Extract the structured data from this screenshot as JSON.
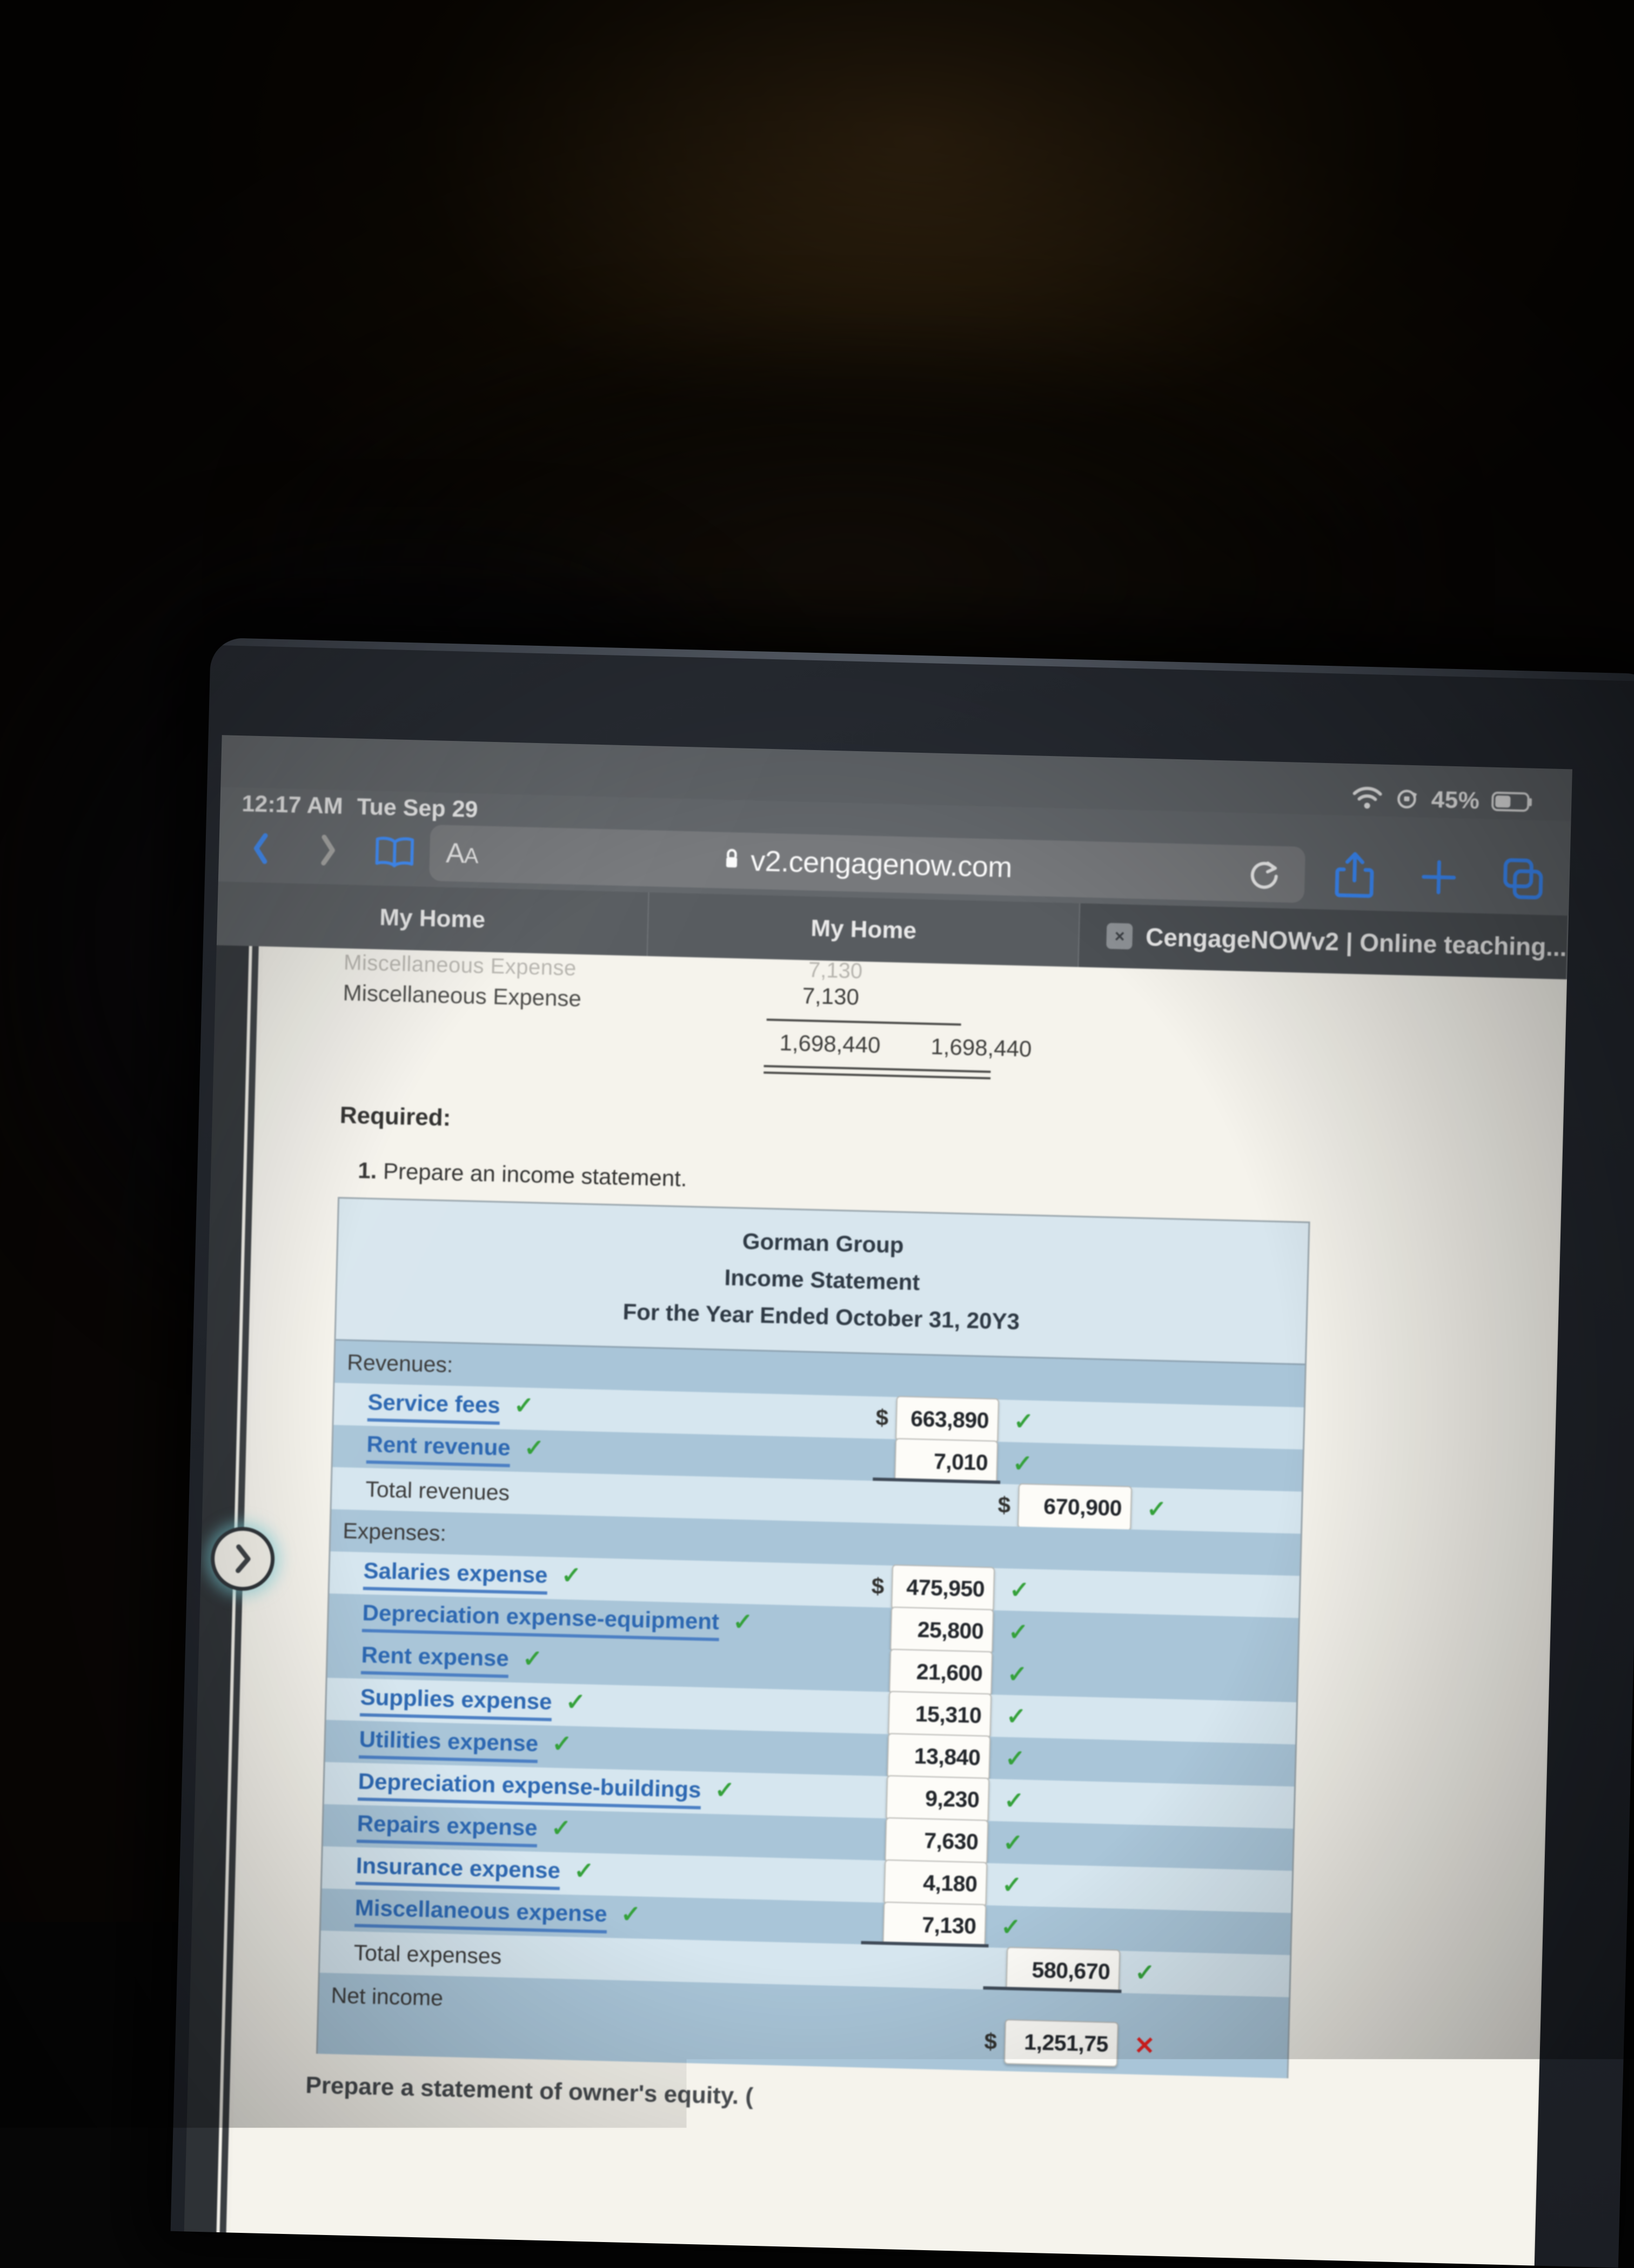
{
  "status_bar": {
    "time": "12:17 AM",
    "date": "Tue Sep 29",
    "battery_percent": "45%",
    "wifi_icon": "wifi-icon",
    "rotation_lock_icon": "rotation-lock-icon",
    "battery_icon": "battery-icon"
  },
  "toolbar": {
    "back_icon": "chevron-left-icon",
    "forward_icon": "chevron-right-icon",
    "bookmarks_icon": "book-icon",
    "text_size_label_big": "A",
    "text_size_label_small": "A",
    "lock_icon": "lock-icon",
    "url": "v2.cengagenow.com",
    "reload_icon": "reload-icon",
    "share_icon": "share-icon",
    "new_tab_icon": "plus-icon",
    "tabs_icon": "tab-overview-icon"
  },
  "tabs": [
    {
      "label": "My Home",
      "active": false,
      "closable": false
    },
    {
      "label": "My Home",
      "active": false,
      "closable": false
    },
    {
      "label": "CengageNOWv2 | Online teaching...",
      "active": true,
      "closable": true,
      "close_label": "×"
    }
  ],
  "page": {
    "trial_balance_fragment": {
      "clipped_row_label": "Miscellaneous Expense",
      "row_label": "Miscellaneous Expense",
      "clipped_amount": "7,130",
      "amount": "7,130",
      "total_debit": "1,698,440",
      "total_credit": "1,698,440"
    },
    "required_heading": "Required:",
    "requirement_number": "1.",
    "requirement_text": "Prepare an income statement.",
    "bottom_note": "Prepare a statement of owner's equity. (",
    "round_nav_icon": "chevron-right-circle-icon"
  },
  "income_statement": {
    "company": "Gorman Group",
    "title": "Income Statement",
    "period": "For the Year Ended October 31, 20Y3",
    "sections": [
      {
        "header": "Revenues:",
        "rows": [
          {
            "label": "Service fees",
            "label_status": "correct",
            "dollar": "$",
            "value": "663,890",
            "status": "correct",
            "column": "a"
          },
          {
            "label": "Rent revenue",
            "label_status": "correct",
            "dollar": "",
            "value": "7,010",
            "status": "correct",
            "column": "a",
            "rule_below": true
          }
        ],
        "total": {
          "label": "Total revenues",
          "dollar": "$",
          "value": "670,900",
          "status": "correct",
          "column": "b"
        }
      },
      {
        "header": "Expenses:",
        "rows": [
          {
            "label": "Salaries expense",
            "label_status": "correct",
            "dollar": "$",
            "value": "475,950",
            "status": "correct",
            "column": "a"
          },
          {
            "label": "Depreciation expense-equipment",
            "label_status": "correct",
            "dollar": "",
            "value": "25,800",
            "status": "correct",
            "column": "a"
          },
          {
            "label": "Rent expense",
            "label_status": "correct",
            "dollar": "",
            "value": "21,600",
            "status": "correct",
            "column": "a"
          },
          {
            "label": "Supplies expense",
            "label_status": "correct",
            "dollar": "",
            "value": "15,310",
            "status": "correct",
            "column": "a"
          },
          {
            "label": "Utilities expense",
            "label_status": "correct",
            "dollar": "",
            "value": "13,840",
            "status": "correct",
            "column": "a"
          },
          {
            "label": "Depreciation expense-buildings",
            "label_status": "correct",
            "dollar": "",
            "value": "9,230",
            "status": "correct",
            "column": "a"
          },
          {
            "label": "Repairs expense",
            "label_status": "correct",
            "dollar": "",
            "value": "7,630",
            "status": "correct",
            "column": "a"
          },
          {
            "label": "Insurance expense",
            "label_status": "correct",
            "dollar": "",
            "value": "4,180",
            "status": "correct",
            "column": "a"
          },
          {
            "label": "Miscellaneous expense",
            "label_status": "correct",
            "dollar": "",
            "value": "7,130",
            "status": "correct",
            "column": "a",
            "rule_below": true
          }
        ],
        "total": {
          "label": "Total expenses",
          "dollar": "",
          "value": "580,670",
          "status": "correct",
          "column": "b"
        }
      }
    ],
    "net_income": {
      "label": "Net income",
      "dollar": "$",
      "value": "1,251,75",
      "status": "incorrect",
      "column": "b"
    },
    "marks": {
      "correct": "✓",
      "incorrect": "✕"
    },
    "colors": {
      "row_dark": "#a9c5d8",
      "row_light": "#d6e6ef",
      "header_bg": "#d8e6ee",
      "link": "#2d68b2",
      "correct": "#34a13a",
      "incorrect": "#e02020"
    }
  }
}
